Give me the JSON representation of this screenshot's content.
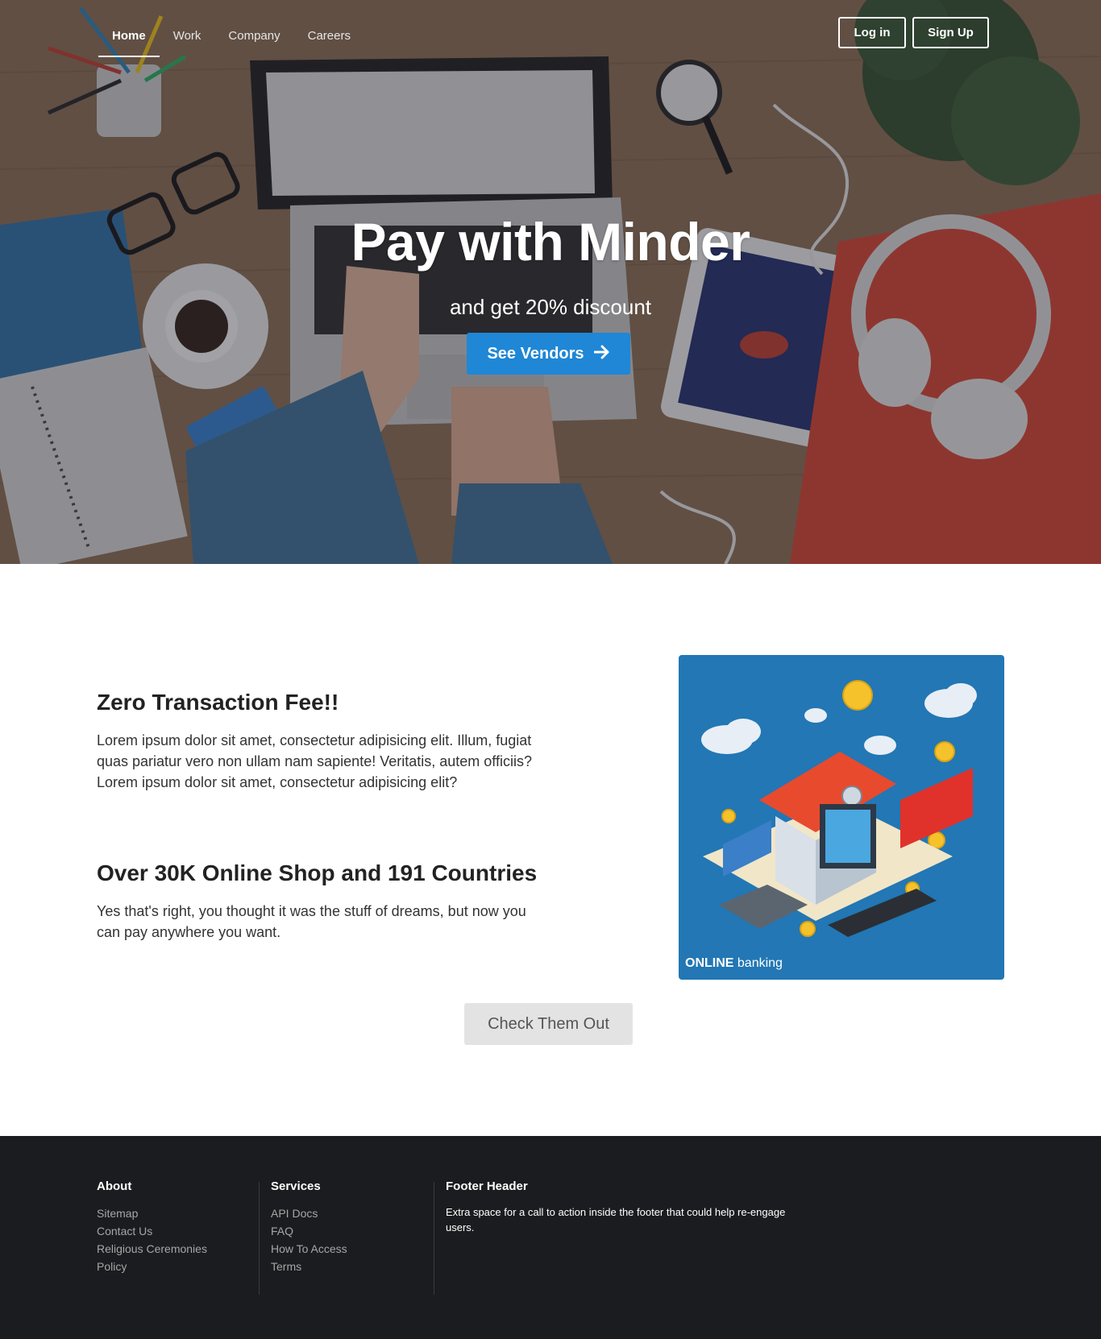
{
  "nav": {
    "items": [
      {
        "label": "Home",
        "active": true
      },
      {
        "label": "Work",
        "active": false
      },
      {
        "label": "Company",
        "active": false
      },
      {
        "label": "Careers",
        "active": false
      }
    ],
    "login_label": "Log in",
    "signup_label": "Sign Up"
  },
  "hero": {
    "title": "Pay with Minder",
    "subtitle": "and get 20% discount",
    "cta_label": "See Vendors",
    "cta_icon": "arrow-right-icon"
  },
  "features": [
    {
      "title": "Zero Transaction Fee!!",
      "text": "Lorem ipsum dolor sit amet, consectetur adipisicing elit. Illum, fugiat quas pariatur vero non ullam nam sapiente! Veritatis, autem officiis? Lorem ipsum dolor sit amet, consectetur adipisicing elit?"
    },
    {
      "title": "Over 30K Online Shop and 191 Countries",
      "text": "Yes that's right, you thought it was the stuff of dreams, but now you can pay anywhere you want."
    }
  ],
  "illustration": {
    "caption_strong": "ONLINE",
    "caption_rest": " banking",
    "background_color": "#2277b4"
  },
  "check_button_label": "Check Them Out",
  "footer": {
    "about": {
      "heading": "About",
      "links": [
        "Sitemap",
        "Contact Us",
        "Religious Ceremonies",
        "Policy"
      ]
    },
    "services": {
      "heading": "Services",
      "links": [
        "API Docs",
        "FAQ",
        "How To Access",
        "Terms"
      ]
    },
    "extra": {
      "heading": "Footer Header",
      "text": "Extra space for a call to action inside the footer that could help re-engage users."
    }
  },
  "colors": {
    "accent": "#1f87d6",
    "footer_bg": "#1b1c1f",
    "secondary_button": "#e3e3e3"
  }
}
